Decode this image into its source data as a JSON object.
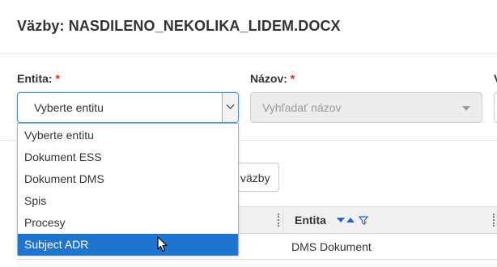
{
  "dialog": {
    "title": "Väzby: NASDILENO_NEKOLIKA_LIDEM.DOCX"
  },
  "form": {
    "entity_label": "Entita:",
    "name_label": "Názov:",
    "third_label": "V",
    "required_mark": "*",
    "entity_selected": "Vyberte entitu",
    "name_placeholder": "Vyhľadať názov"
  },
  "dropdown": {
    "options": [
      "Vyberte entitu",
      "Dokument ESS",
      "Dokument DMS",
      "Spis",
      "Procesy",
      "Subject ADR"
    ],
    "highlighted_index": 5
  },
  "toolbar": {
    "vazby_button_partial": "väzby"
  },
  "table": {
    "columns": [
      {
        "label": "Entita"
      }
    ],
    "rows": [
      {
        "entita": "DMS Dokument"
      }
    ]
  },
  "icons": {
    "select_arrow": "chevron-down-icon",
    "name_arrow": "caret-down-icon",
    "sort_desc": "sort-desc-icon",
    "sort_asc": "sort-asc-icon",
    "filter": "filter-icon",
    "cursor": "mouse-pointer-icon"
  },
  "colors": {
    "accent": "#1f75cd",
    "required": "#d9261c",
    "focus_border": "#3d8fd6"
  }
}
